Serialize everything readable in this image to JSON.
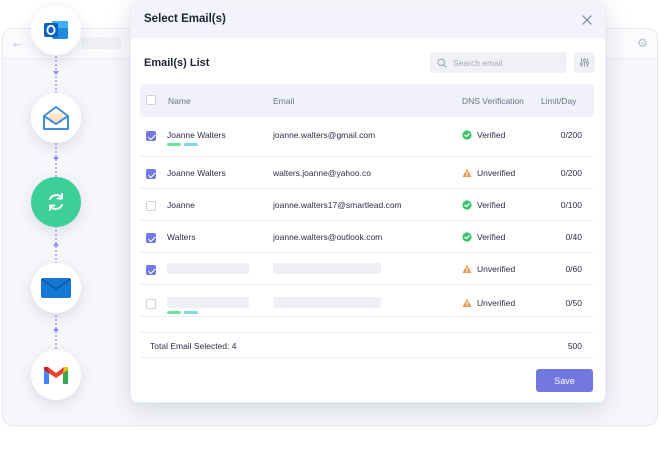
{
  "modal": {
    "title": "Select Email(s)",
    "section_title": "Email(s) List",
    "search_placeholder": "Search email",
    "save_label": "Save"
  },
  "table": {
    "headers": [
      "Name",
      "Email",
      "DNS Verification",
      "Limit/Day"
    ],
    "rows": [
      {
        "name": "Joanne Walters",
        "email": "joanne.walters@gmail.com",
        "dns": "Verified",
        "limit": "0/200",
        "checked": true,
        "tags": true
      },
      {
        "name": "Joanne Walters",
        "email": "walters.joanne@yahoo.co",
        "dns": "Unverified",
        "limit": "0/200",
        "checked": true,
        "tags": false
      },
      {
        "name": "Joanne",
        "email": "joanne.walters17@smartlead.com",
        "dns": "Verified",
        "limit": "0/100",
        "checked": false,
        "tags": false
      },
      {
        "name": "Walters",
        "email": "joanne.walters@outlook.com",
        "dns": "Verified",
        "limit": "0/40",
        "checked": true,
        "tags": false
      },
      {
        "name": "",
        "email": "",
        "dns": "Unverified",
        "limit": "0/60",
        "checked": true,
        "tags": false
      },
      {
        "name": "",
        "email": "",
        "dns": "Unverified",
        "limit": "0/50",
        "checked": false,
        "tags": true
      }
    ],
    "footer_label": "Total Email Selected: 4",
    "footer_total": "500"
  },
  "rail": {
    "icons": [
      "outlook-icon",
      "open-envelope-icon",
      "sync-icon",
      "mail-icon",
      "gmail-icon"
    ]
  },
  "colors": {
    "accent": "#7278e0",
    "verified": "#3cc46b",
    "unverified": "#e89a54",
    "sync": "#3ccf9a",
    "tag_green": "#6ee3a1",
    "tag_cyan": "#7fd8e8"
  }
}
